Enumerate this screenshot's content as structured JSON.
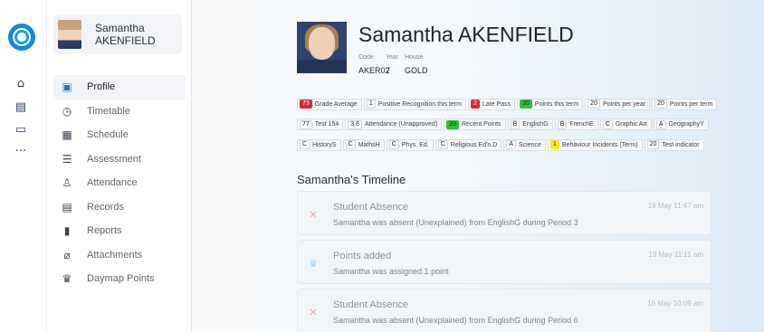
{
  "rail": {
    "icons": [
      "logo",
      "home-icon",
      "message-icon",
      "calendar-icon",
      "more-icon"
    ]
  },
  "user": {
    "first_name": "Samantha",
    "last_name": "AKENFIELD"
  },
  "nav": {
    "items": [
      {
        "label": "Profile",
        "icon": "profile-icon"
      },
      {
        "label": "Timetable",
        "icon": "clock-icon"
      },
      {
        "label": "Schedule",
        "icon": "calendar-icon"
      },
      {
        "label": "Assessment",
        "icon": "list-icon"
      },
      {
        "label": "Attendance",
        "icon": "person-check-icon"
      },
      {
        "label": "Records",
        "icon": "clipboard-icon"
      },
      {
        "label": "Reports",
        "icon": "document-icon"
      },
      {
        "label": "Attachments",
        "icon": "paperclip-icon"
      },
      {
        "label": "Daymap Points",
        "icon": "trophy-icon"
      }
    ],
    "active": "Profile"
  },
  "profile": {
    "name": "Samantha AKENFIELD",
    "code_label": "Code",
    "code": "AKER02",
    "year_label": "Year",
    "year": "7",
    "house_label": "House",
    "house": "GOLD"
  },
  "badges": [
    {
      "value": "73",
      "label": "Grade Average",
      "color": "#e0242f"
    },
    {
      "value": "1",
      "label": "Positive Recognition this term",
      "color": "#ffffff"
    },
    {
      "value": "2",
      "label": "Late Pass",
      "color": "#e0242f"
    },
    {
      "value": "20",
      "label": "Points this term",
      "color": "#33c13a"
    },
    {
      "value": "20",
      "label": "Points per year",
      "color": "#ffffff"
    },
    {
      "value": "20",
      "label": "Points per term",
      "color": "#ffffff"
    },
    {
      "value": "77",
      "label": "Test 154",
      "color": "#ffffff"
    },
    {
      "value": "3.6",
      "label": "Attendance (Unapproved)",
      "color": "#ffffff"
    },
    {
      "value": "20",
      "label": "Recent Points",
      "color": "#2dbb3b"
    },
    {
      "value": "B",
      "label": "EnglishG",
      "color": "#ffffff"
    },
    {
      "value": "B",
      "label": "FrenchE",
      "color": "#ffffff"
    },
    {
      "value": "C",
      "label": "Graphic Art",
      "color": "#ffffff"
    },
    {
      "value": "A",
      "label": "GeographyY",
      "color": "#ffffff"
    },
    {
      "value": "C",
      "label": "HistoryS",
      "color": "#ffffff"
    },
    {
      "value": "C",
      "label": "MathsH",
      "color": "#ffffff"
    },
    {
      "value": "C",
      "label": "Phys. Ed.",
      "color": "#ffffff"
    },
    {
      "value": "C",
      "label": "Religious Ed'n.D",
      "color": "#ffffff"
    },
    {
      "value": "A",
      "label": "Science",
      "color": "#ffffff"
    },
    {
      "value": "1",
      "label": "Behaviour Incidents (Term)",
      "color": "#f4ea1c"
    },
    {
      "value": "20",
      "label": "Test indicator",
      "color": "#ffffff"
    }
  ],
  "timeline": {
    "title": "Samantha's Timeline",
    "items": [
      {
        "icon": "close-icon",
        "title": "Student Absence",
        "description": "Samantha was absent (Unexplained) from EnglishG during Period 3",
        "time": "19 May 11:47 am"
      },
      {
        "icon": "trophy-icon",
        "title": "Points added",
        "description": "Samantha was assigned 1 point",
        "time": "19 May 11:11 am"
      },
      {
        "icon": "close-icon",
        "title": "Student Absence",
        "description": "Samantha was absent (Unexplained) from EnglishG during Period 6",
        "time": "16 May 10:09 am"
      }
    ]
  }
}
